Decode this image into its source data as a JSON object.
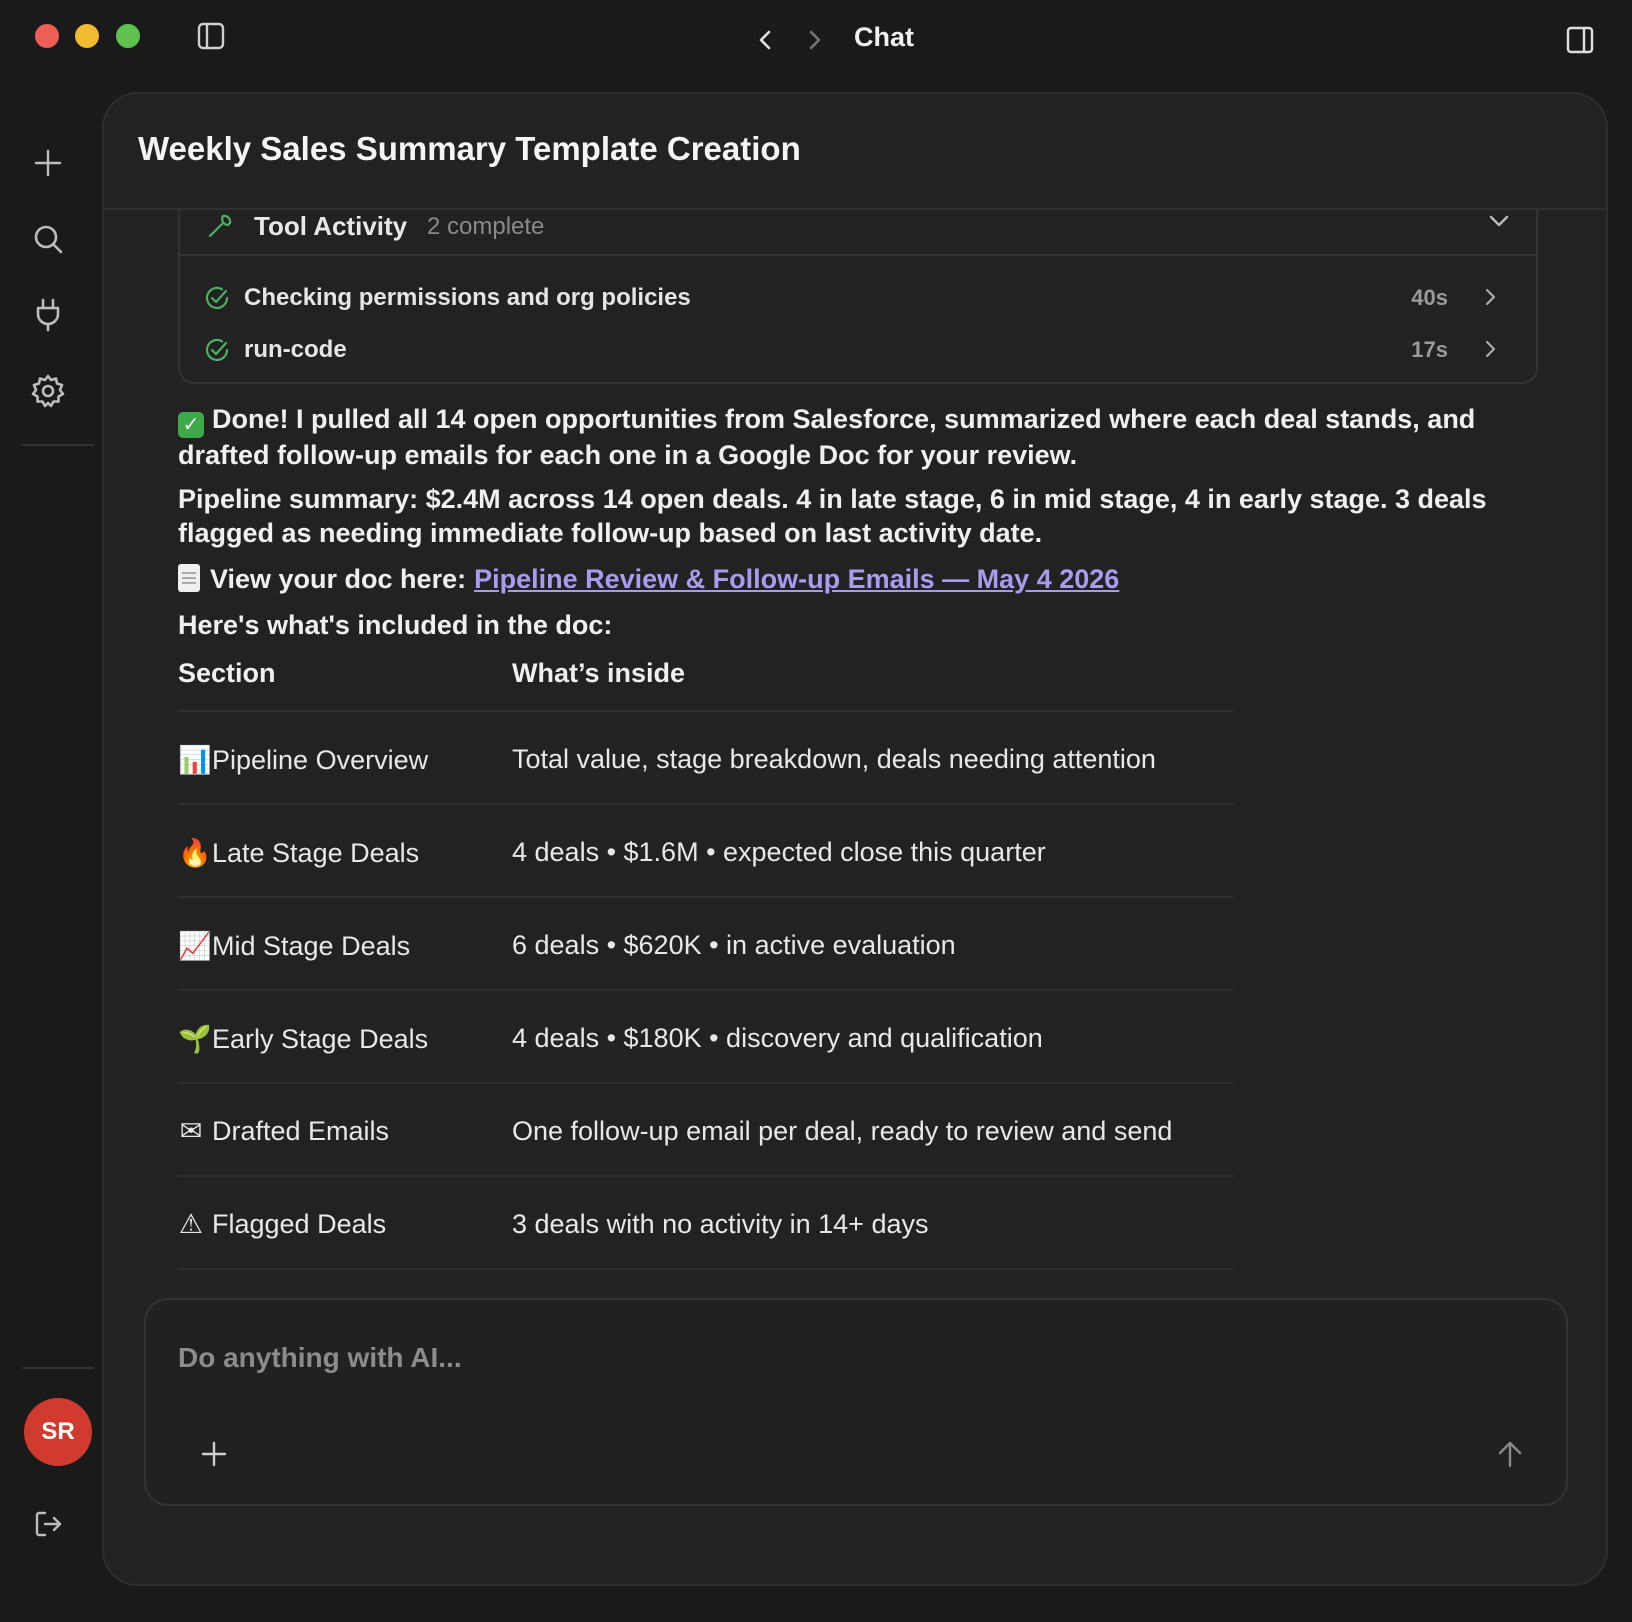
{
  "window": {
    "title": "Chat"
  },
  "chat": {
    "title": "Weekly Sales Summary Template Creation"
  },
  "tool_activity": {
    "label": "Tool Activity",
    "count": "2 complete",
    "items": [
      {
        "label": "Checking permissions and org policies",
        "duration": "40s"
      },
      {
        "label": "run-code",
        "duration": "17s"
      }
    ]
  },
  "message": {
    "done_text": "Done! I pulled all 14 open opportunities from Salesforce, summarized where each deal stands, and drafted follow-up emails for each one in a Google Doc for your review.",
    "pipeline_text": "Pipeline summary: $2.4M across 14 open deals. 4 in late stage, 6 in mid stage, 4 in early stage. 3 deals flagged as needing immediate follow-up based on last activity date.",
    "doc_prefix": "View your doc here:",
    "doc_link": "Pipeline Review & Follow-up Emails — May 4 2026",
    "included_text": "Here's what's included in the doc:"
  },
  "table": {
    "headers": [
      "Section",
      "What’s inside"
    ],
    "rows": [
      {
        "emoji": "📊",
        "section": "Pipeline Overview",
        "inside": "Total value, stage breakdown, deals needing attention"
      },
      {
        "emoji": "🔥",
        "section": "Late Stage Deals",
        "inside": "4 deals • $1.6M • expected close this quarter"
      },
      {
        "emoji": "📈",
        "section": "Mid Stage Deals",
        "inside": "6 deals • $620K • in active evaluation"
      },
      {
        "emoji": "🌱",
        "section": "Early Stage Deals",
        "inside": "4 deals • $180K • discovery and qualification"
      },
      {
        "emoji": "✉",
        "section": "Drafted Emails",
        "inside": "One follow-up email per deal, ready to review and send"
      },
      {
        "emoji": "⚠",
        "section": "Flagged Deals",
        "inside": "3 deals with no activity in 14+ days"
      }
    ]
  },
  "composer": {
    "placeholder": "Do anything with AI..."
  },
  "user": {
    "initials": "SR"
  },
  "colors": {
    "avatar": "#d03a2f",
    "link": "#a79cf0",
    "success": "#3ea84a"
  }
}
